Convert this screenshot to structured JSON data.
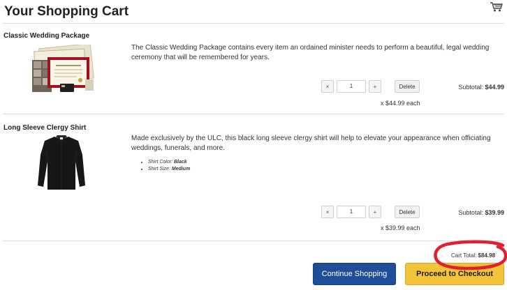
{
  "page": {
    "title": "Your Shopping Cart",
    "cart_icon": "shopping-cart-icon"
  },
  "items": [
    {
      "name": "Classic Wedding Package",
      "description": "The Classic Wedding Package contains every item an ordained minister needs to perform a beautiful, legal wedding ceremony that will be remembered for years.",
      "options": [],
      "quantity": "1",
      "decrement_label": "×",
      "increment_label": "+",
      "delete_label": "Delete",
      "subtotal_label": "Subtotal:",
      "subtotal_value": "$44.99",
      "each_price": "x $44.99 each",
      "image": "wedding-package-image"
    },
    {
      "name": "Long Sleeve Clergy Shirt",
      "description": "Made exclusively by the ULC, this black long sleeve clergy shirt will help to elevate your appearance when officiating weddings, funerals, and more.",
      "options": [
        {
          "label": "Shirt Color:",
          "value": "Black"
        },
        {
          "label": "Shirt Size:",
          "value": "Medium"
        }
      ],
      "quantity": "1",
      "decrement_label": "×",
      "increment_label": "+",
      "delete_label": "Delete",
      "subtotal_label": "Subtotal:",
      "subtotal_value": "$39.99",
      "each_price": "x $39.99 each",
      "image": "clergy-shirt-image"
    }
  ],
  "cart": {
    "total_label": "Cart Total:",
    "total_value": "$84.98"
  },
  "actions": {
    "continue_label": "Continue Shopping",
    "checkout_label": "Proceed to Checkout"
  },
  "colors": {
    "continue_button": "#1d4e97",
    "checkout_button": "#f3c33c",
    "highlight_ring": "#e0202c"
  }
}
